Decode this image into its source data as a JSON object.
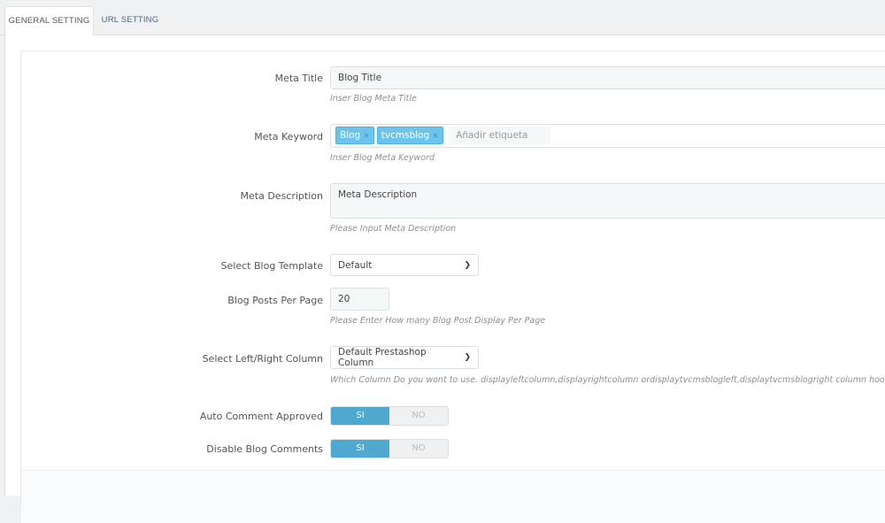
{
  "tabs": [
    {
      "label": "GENERAL SETTING",
      "active": true
    },
    {
      "label": "URL SETTING",
      "active": false
    }
  ],
  "form": {
    "meta_title": {
      "label": "Meta Title",
      "value": "Blog Title",
      "help": "Inser Blog Meta Title"
    },
    "meta_keyword": {
      "label": "Meta Keyword",
      "tags": [
        "Blog",
        "tvcmsblog"
      ],
      "placeholder": "Añadir etiqueta",
      "help": "Inser Blog Meta Keyword",
      "remove_glyph": "×"
    },
    "meta_description": {
      "label": "Meta Description",
      "value": "Meta Description",
      "help": "Please Input Meta Description"
    },
    "blog_template": {
      "label": "Select Blog Template",
      "value": "Default"
    },
    "posts_per_page": {
      "label": "Blog Posts Per Page",
      "value": "20",
      "help": "Please Enter How many Blog Post Display Per Page"
    },
    "column": {
      "label": "Select Left/Right Column",
      "value": "Default Prestashop Column",
      "help": "Which Column Do you wont to use. displayleftcolumn,displayrightcolumn ordisplaytvcmsblogleft,displaytvcmsblogright column hook."
    },
    "auto_comment": {
      "label": "Auto Comment Approved",
      "on": "SI",
      "off": "NO",
      "selected": "SI"
    },
    "disable_comments": {
      "label": "Disable Blog Comments",
      "on": "SI",
      "off": "NO",
      "selected": "SI"
    }
  },
  "colors": {
    "accent": "#4fa8cf",
    "tag": "#6cc3ec"
  }
}
